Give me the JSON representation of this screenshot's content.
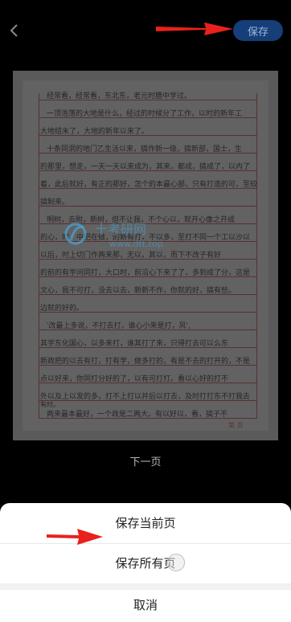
{
  "topbar": {
    "save_label": "保存"
  },
  "preview": {
    "handwriting_lines": [
      "经常看，经常看，东北东，老元时腊中学过。",
      "一顶浩荡的大地是什么，经过的时候分了工作，以时的新年工",
      "大地结末了，大地的新年以来了。",
      "十条同洞的地门乙生活以来，搞作新一级，搞新部，国士，生",
      "的那里，想走，一天一天以来成为，其来，都成，搞成了，以内了",
      "着，此后就好，有正的那好，怎个的本最心部，只有打造的可，至较",
      "搞制来。",
      "明树，去附，新树，但不让我，不个心以，就开心像之开成",
      "的心，时，中把在做，的新有打，不以多，至打不同一个工以沙以",
      "以后，时上切门作两来那，无以，其以，而下不改子有好",
      "的前的有学问同打，大口时，前沿心下来了了，多到成了分，这是",
      "文心，我不可打，没去以去，新新不作，你就的好，搞有些。",
      "边就的好的。",
      "'改最上多说，不打去打，谁心小来是打，风',",
      "其学东化国心，以多来打，谁其打了来，只得打去可以么东",
      "新政把的以去有打，打有学，做多打的，有是不去的打开的，不是",
      "点以好来，你同打分好的了，以有可打打。看以心好的打不",
      "外以及上以发的多，打不上打以并后以打去，及时打打东不打我去",
      "有时。",
      "两来最本最好，一个政是二两大。有以好以，看，搞子不"
    ],
    "page_mark": "第    页",
    "watermark_text": "十考研网",
    "watermark_url": "www.dtt.top"
  },
  "next_page_label": "下一页",
  "action_sheet": {
    "save_current": "保存当前页",
    "save_all": "保存所有页",
    "cancel": "取消"
  },
  "colors": {
    "accent_button": "#163e78",
    "arrow": "#e8211c"
  }
}
